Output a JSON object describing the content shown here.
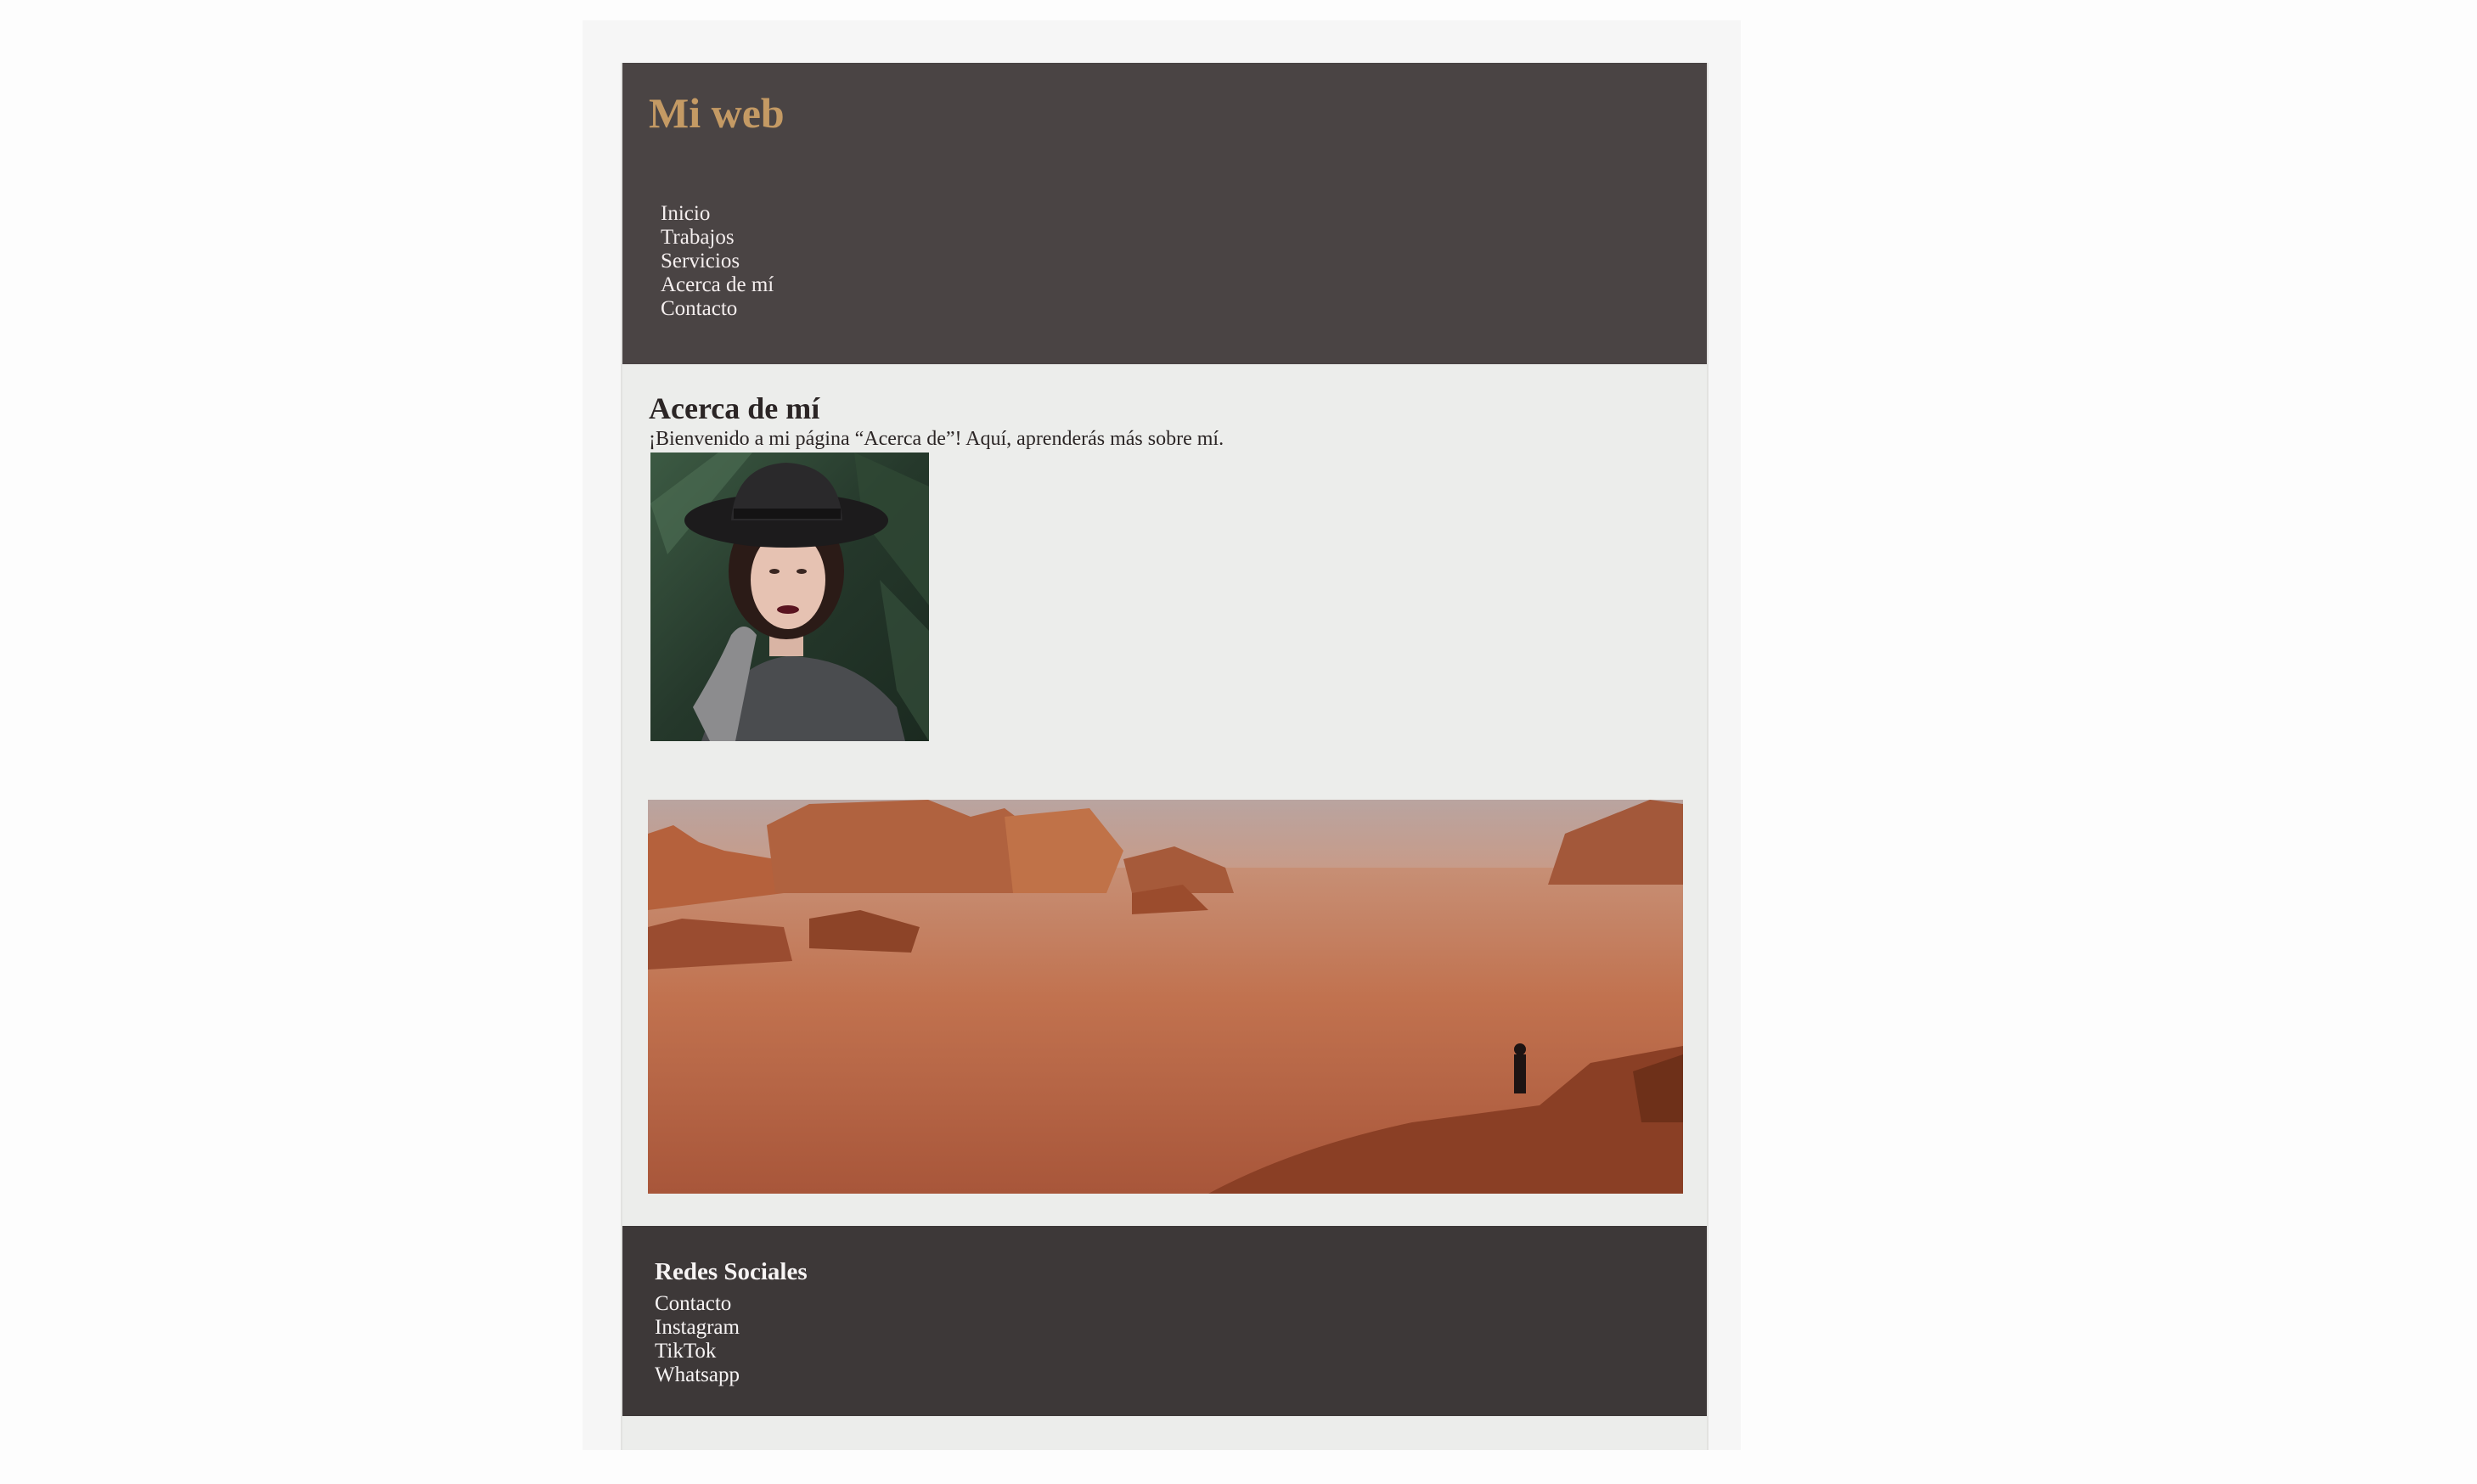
{
  "header": {
    "title": "Mi web",
    "nav": [
      "Inicio",
      "Trabajos",
      "Servicios",
      "Acerca de mí",
      "Contacto"
    ]
  },
  "main": {
    "heading": "Acerca de mí",
    "intro": "¡Bienvenido a mi página “Acerca de”! Aquí, aprenderás más sobre mí."
  },
  "footer": {
    "title": "Redes Sociales",
    "links": [
      "Contacto",
      "Instagram",
      "TikTok",
      "Whatsapp"
    ]
  },
  "colors": {
    "page_background": "#ecedeb",
    "header_background": "#4a4444",
    "footer_background": "#3d3838",
    "title_accent": "#c49a64",
    "text_dark": "#2b2525",
    "text_light": "#f4eeee"
  }
}
